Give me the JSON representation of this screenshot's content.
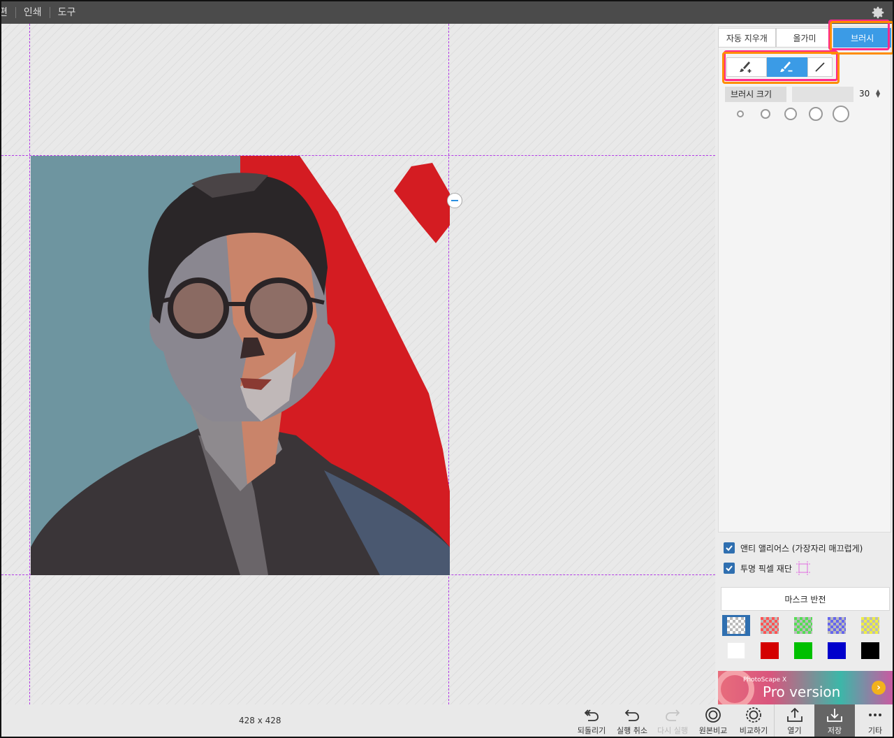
{
  "menu": {
    "items": [
      "편",
      "인쇄",
      "도구"
    ]
  },
  "canvas": {
    "dimensions": "428 x 428"
  },
  "panel": {
    "tabs": [
      {
        "label": "자동 지우개",
        "active": false
      },
      {
        "label": "올가미",
        "active": false
      },
      {
        "label": "브러시",
        "active": true
      }
    ],
    "modes": [
      {
        "icon": "brush-add-icon",
        "active": false
      },
      {
        "icon": "brush-subtract-icon",
        "active": true
      },
      {
        "icon": "line-icon",
        "active": false
      }
    ],
    "brush_size": {
      "label": "브러시 크기",
      "value": "30"
    },
    "presets": [
      10,
      14,
      18,
      22,
      26
    ],
    "options": {
      "antialias": "앤티 앨리어스 (가장자리 매끄럽게)",
      "trim": "투명 픽셀 재단"
    },
    "mask_invert": "마스크 반전",
    "swatches": [
      {
        "color": "checker",
        "tint": "#ffffff"
      },
      {
        "color": "checker",
        "tint": "#ff5555"
      },
      {
        "color": "checker",
        "tint": "#55dd55"
      },
      {
        "color": "checker",
        "tint": "#6666ee"
      },
      {
        "color": "checker",
        "tint": "#eeee44"
      },
      {
        "color": "#ffffff"
      },
      {
        "color": "#d40000"
      },
      {
        "color": "#00c000"
      },
      {
        "color": "#0000cc"
      },
      {
        "color": "#000000"
      }
    ],
    "ad": {
      "small": "PhotoScape X",
      "big": "Pro version"
    }
  },
  "actions": [
    {
      "label": "되돌리기",
      "icon": "revert-icon"
    },
    {
      "label": "실행 취소",
      "icon": "undo-icon"
    },
    {
      "label": "다시 실행",
      "icon": "redo-icon",
      "disabled": true
    },
    {
      "label": "원본비교",
      "icon": "compare-original-icon"
    },
    {
      "label": "비교하기",
      "icon": "compare-icon"
    },
    {
      "label": "열기",
      "icon": "open-icon"
    },
    {
      "label": "저장",
      "icon": "save-icon"
    },
    {
      "label": "기타",
      "icon": "more-icon"
    }
  ],
  "colors": {
    "accent": "#3b9be6",
    "highlight_pink": "#ff2a8a",
    "highlight_orange": "#ff8c00",
    "topbar": "#4b4b4b"
  }
}
